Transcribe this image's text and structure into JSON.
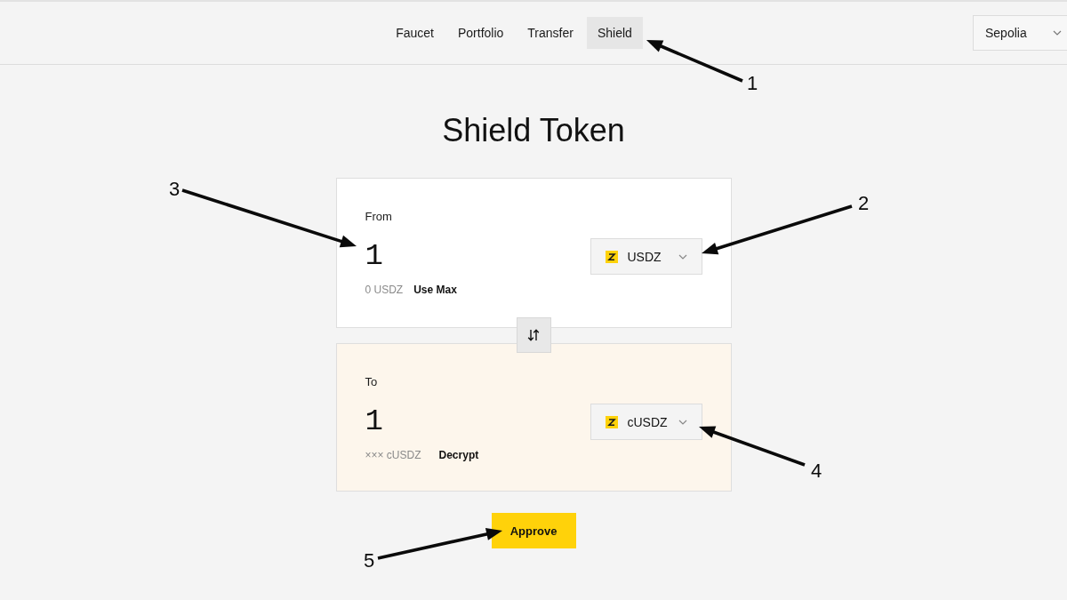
{
  "nav": {
    "tabs": [
      {
        "label": "Faucet",
        "selected": false
      },
      {
        "label": "Portfolio",
        "selected": false
      },
      {
        "label": "Transfer",
        "selected": false
      },
      {
        "label": "Shield",
        "selected": true
      }
    ],
    "network_select": {
      "value": "Sepolia"
    }
  },
  "title": "Shield Token",
  "panels": [
    {
      "kind": "from",
      "label": "From",
      "amount": "1",
      "token": "USDZ",
      "balance": "0 USDZ",
      "action": "Use Max"
    },
    {
      "kind": "to",
      "label": "To",
      "amount": "1",
      "token": "cUSDZ",
      "balance": "××× cUSDZ",
      "action": "Decrypt"
    }
  ],
  "primary_button": {
    "label": "Approve"
  },
  "annotations": [
    {
      "label": "1"
    },
    {
      "label": "2"
    },
    {
      "label": "3"
    },
    {
      "label": "4"
    },
    {
      "label": "5"
    }
  ]
}
